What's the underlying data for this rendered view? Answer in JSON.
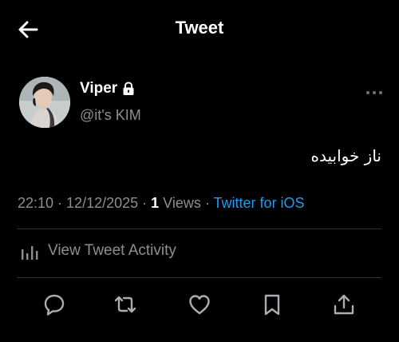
{
  "header": {
    "back_icon": "arrow-left-icon",
    "title": "Tweet"
  },
  "author": {
    "display_name": "Viper",
    "protected_icon": "lock-icon",
    "handle": "@it's KIM",
    "avatar_icon": "avatar-photo"
  },
  "more_icon": "more-horizontal-icon",
  "tweet": {
    "text": "ناز خوابیده",
    "time": "22:10",
    "date": "12/12/2025",
    "views_count": "1",
    "views_label": "Views",
    "source": "Twitter for iOS",
    "separator": " · "
  },
  "activity": {
    "icon": "bar-chart-icon",
    "label": "View Tweet Activity"
  },
  "actions": [
    {
      "name": "reply",
      "icon": "reply-icon"
    },
    {
      "name": "retweet",
      "icon": "retweet-icon"
    },
    {
      "name": "like",
      "icon": "heart-icon"
    },
    {
      "name": "bookmark",
      "icon": "bookmark-icon"
    },
    {
      "name": "share",
      "icon": "share-icon"
    }
  ],
  "colors": {
    "background": "#000000",
    "primary_text": "#e7e9ea",
    "secondary_text": "#8b8f94",
    "accent": "#1d9bf0",
    "divider": "#2f3336"
  }
}
